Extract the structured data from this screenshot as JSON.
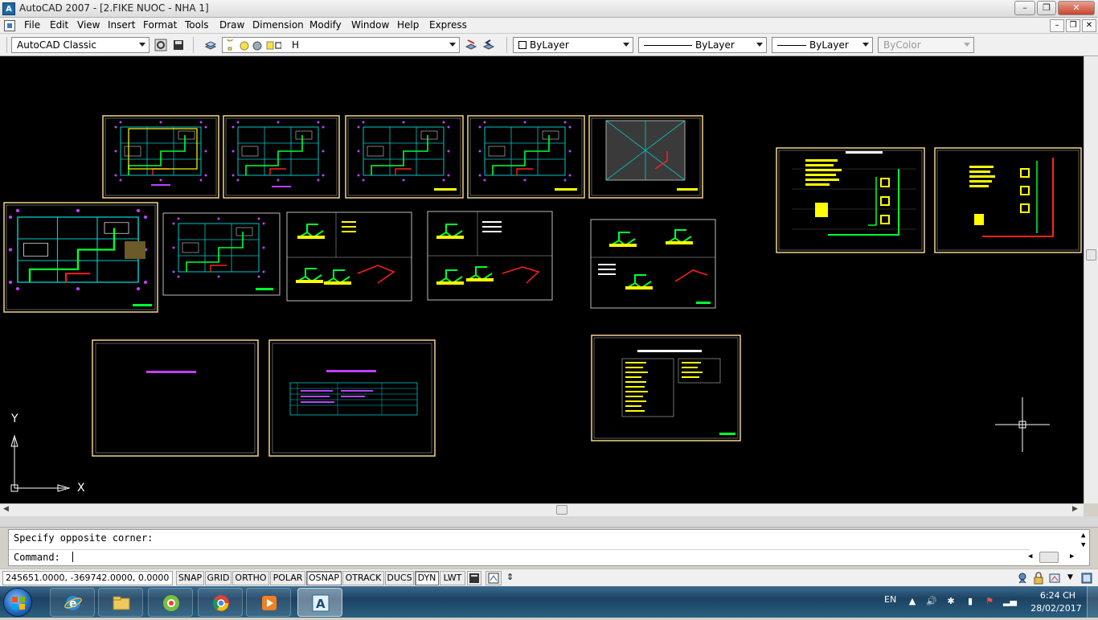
{
  "window": {
    "title": "AutoCAD 2007 - [2.FIKE NUOC - NHA 1]",
    "minimize_glyph": "–",
    "maximize_glyph": "❐",
    "close_glyph": "✕"
  },
  "menu": {
    "items": [
      "File",
      "Edit",
      "View",
      "Insert",
      "Format",
      "Tools",
      "Draw",
      "Dimension",
      "Modify",
      "Window",
      "Help",
      "Express"
    ],
    "mdi_minimize": "–",
    "mdi_restore": "❐",
    "mdi_close": "✕"
  },
  "toolbar": {
    "workspace": "AutoCAD Classic",
    "layer": "H",
    "color": "ByLayer",
    "linetype": "ByLayer",
    "lineweight": "ByLayer",
    "plotstyle": "ByColor"
  },
  "drawing": {
    "background": "#000000",
    "ucs_y_label": "Y",
    "ucs_x_label": "X"
  },
  "command": {
    "history_line": "Specify opposite corner:",
    "prompt": "Command:"
  },
  "status": {
    "coordinates": "245651.0000, -369742.0000, 0.0000",
    "toggles": [
      {
        "label": "SNAP",
        "on": false
      },
      {
        "label": "GRID",
        "on": false
      },
      {
        "label": "ORTHO",
        "on": false
      },
      {
        "label": "POLAR",
        "on": false
      },
      {
        "label": "OSNAP",
        "on": true
      },
      {
        "label": "OTRACK",
        "on": false
      },
      {
        "label": "DUCS",
        "on": false
      },
      {
        "label": "DYN",
        "on": true
      },
      {
        "label": "LWT",
        "on": false
      }
    ]
  },
  "taskbar": {
    "language": "EN",
    "time": "6:24 CH",
    "date": "28/02/2017",
    "apps": [
      "windows-explorer",
      "coccoc-browser",
      "chrome",
      "media-player",
      "autocad"
    ]
  },
  "colors": {
    "sheet_frame": "#f2d28a",
    "plan_cyan": "#00c8c8",
    "pipe_green": "#00ff30",
    "text_yellow": "#ffff00",
    "pipe_red": "#ff2020",
    "crosshair": "#ffffff"
  }
}
